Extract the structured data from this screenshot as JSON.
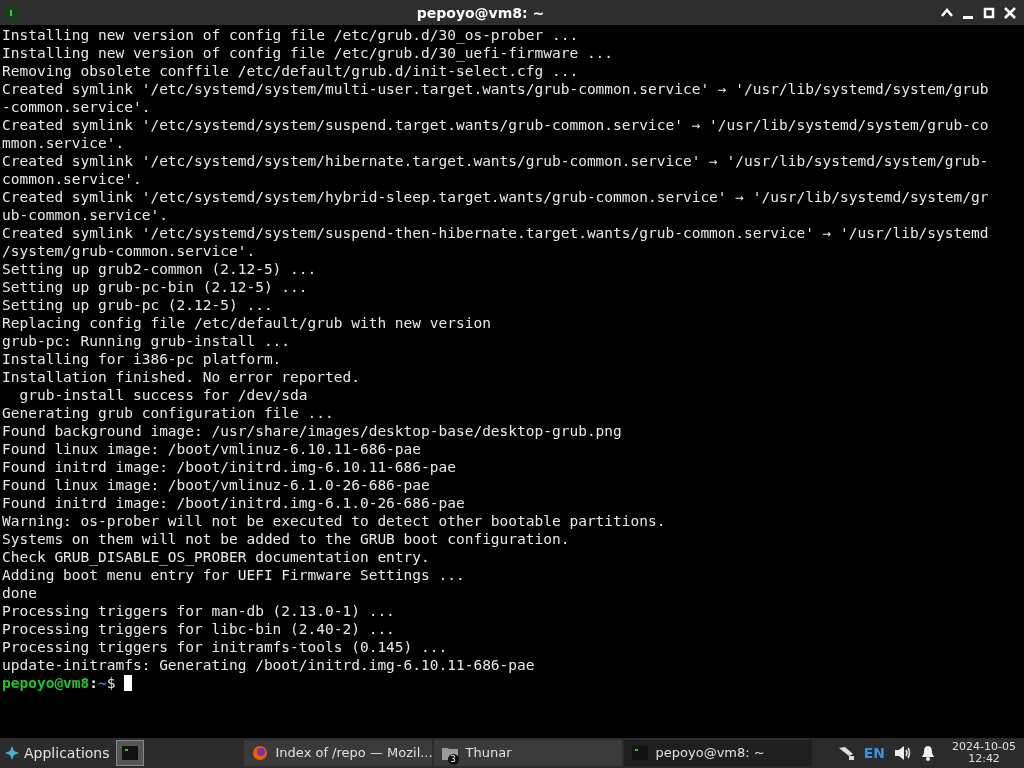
{
  "window": {
    "title": "pepoyo@vm8: ~"
  },
  "terminal": {
    "lines": [
      "Installing new version of config file /etc/grub.d/30_os-prober ...",
      "Installing new version of config file /etc/grub.d/30_uefi-firmware ...",
      "Removing obsolete conffile /etc/default/grub.d/init-select.cfg ...",
      "Created symlink '/etc/systemd/system/multi-user.target.wants/grub-common.service' → '/usr/lib/systemd/system/grub",
      "-common.service'.",
      "Created symlink '/etc/systemd/system/suspend.target.wants/grub-common.service' → '/usr/lib/systemd/system/grub-co",
      "mmon.service'.",
      "Created symlink '/etc/systemd/system/hibernate.target.wants/grub-common.service' → '/usr/lib/systemd/system/grub-",
      "common.service'.",
      "Created symlink '/etc/systemd/system/hybrid-sleep.target.wants/grub-common.service' → '/usr/lib/systemd/system/gr",
      "ub-common.service'.",
      "Created symlink '/etc/systemd/system/suspend-then-hibernate.target.wants/grub-common.service' → '/usr/lib/systemd",
      "/system/grub-common.service'.",
      "Setting up grub2-common (2.12-5) ...",
      "Setting up grub-pc-bin (2.12-5) ...",
      "Setting up grub-pc (2.12-5) ...",
      "Replacing config file /etc/default/grub with new version",
      "grub-pc: Running grub-install ...",
      "Installing for i386-pc platform.",
      "Installation finished. No error reported.",
      "  grub-install success for /dev/sda",
      "Generating grub configuration file ...",
      "Found background image: /usr/share/images/desktop-base/desktop-grub.png",
      "Found linux image: /boot/vmlinuz-6.10.11-686-pae",
      "Found initrd image: /boot/initrd.img-6.10.11-686-pae",
      "Found linux image: /boot/vmlinuz-6.1.0-26-686-pae",
      "Found initrd image: /boot/initrd.img-6.1.0-26-686-pae",
      "Warning: os-prober will not be executed to detect other bootable partitions.",
      "Systems on them will not be added to the GRUB boot configuration.",
      "Check GRUB_DISABLE_OS_PROBER documentation entry.",
      "Adding boot menu entry for UEFI Firmware Settings ...",
      "done",
      "Processing triggers for man-db (2.13.0-1) ...",
      "Processing triggers for libc-bin (2.40-2) ...",
      "Processing triggers for initramfs-tools (0.145) ...",
      "update-initramfs: Generating /boot/initrd.img-6.10.11-686-pae"
    ],
    "prompt": {
      "user_host": "pepoyo@vm8",
      "separator": ":",
      "path": "~",
      "symbol": "$"
    }
  },
  "taskbar": {
    "menu": "Applications",
    "windows": [
      {
        "kind": "browser",
        "label": "Index of /repo — Mozil...",
        "selected": false
      },
      {
        "kind": "files",
        "label": "Thunar",
        "badge": "3",
        "selected": false
      },
      {
        "kind": "terminal",
        "label": "pepoyo@vm8: ~",
        "selected": true
      }
    ],
    "keyboard_layout": "EN",
    "date": "2024-10-05",
    "time": "12:42"
  }
}
